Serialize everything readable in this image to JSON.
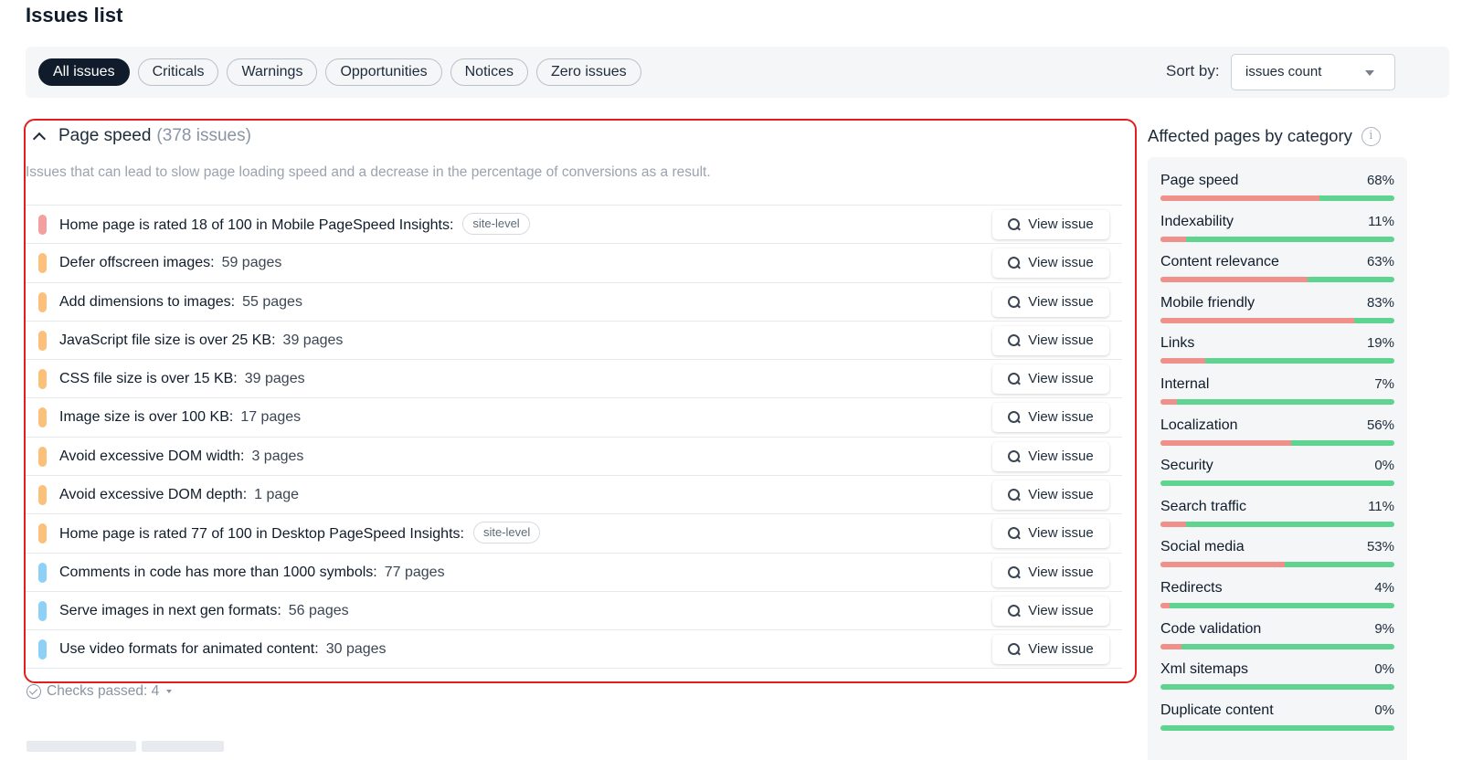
{
  "page": {
    "title": "Issues list"
  },
  "filters": {
    "tabs": [
      "All issues",
      "Criticals",
      "Warnings",
      "Opportunities",
      "Notices",
      "Zero issues"
    ],
    "active": "All issues",
    "sort_label": "Sort by:",
    "sort_value": "issues count"
  },
  "section": {
    "title": "Page speed",
    "count": "(378 issues)",
    "description": "Issues that can lead to slow page loading speed and a decrease in the percentage of conversions as a result.",
    "view_label": "View issue",
    "issues": [
      {
        "text": "Home page is rated 18 of 100 in Mobile PageSpeed Insights:",
        "pages": "",
        "badge": "site-level",
        "severity": "critical"
      },
      {
        "text": "Defer offscreen images:",
        "pages": "59 pages",
        "badge": "",
        "severity": "warning"
      },
      {
        "text": "Add dimensions to images:",
        "pages": "55 pages",
        "badge": "",
        "severity": "warning"
      },
      {
        "text": "JavaScript file size is over 25 KB:",
        "pages": "39 pages",
        "badge": "",
        "severity": "warning"
      },
      {
        "text": "CSS file size is over 15 KB:",
        "pages": "39 pages",
        "badge": "",
        "severity": "warning"
      },
      {
        "text": "Image size is over 100 KB:",
        "pages": "17 pages",
        "badge": "",
        "severity": "warning"
      },
      {
        "text": "Avoid excessive DOM width:",
        "pages": "3 pages",
        "badge": "",
        "severity": "warning"
      },
      {
        "text": "Avoid excessive DOM depth:",
        "pages": "1 page",
        "badge": "",
        "severity": "warning"
      },
      {
        "text": "Home page is rated 77 of 100 in Desktop PageSpeed Insights:",
        "pages": "",
        "badge": "site-level",
        "severity": "warning"
      },
      {
        "text": "Comments in code has more than 1000 symbols:",
        "pages": "77 pages",
        "badge": "",
        "severity": "opportunity"
      },
      {
        "text": "Serve images in next gen formats:",
        "pages": "56 pages",
        "badge": "",
        "severity": "opportunity"
      },
      {
        "text": "Use video formats for animated content:",
        "pages": "30 pages",
        "badge": "",
        "severity": "opportunity"
      }
    ],
    "checks_passed": "Checks passed: 4"
  },
  "severity_colors": {
    "critical": "#f4a0a0",
    "warning": "#fbc07a",
    "opportunity": "#8fd0f7"
  },
  "sidebar": {
    "title": "Affected pages by category",
    "info_icon": "i",
    "categories": [
      {
        "name": "Page speed",
        "pct": "68%",
        "value": 0.68
      },
      {
        "name": "Indexability",
        "pct": "11%",
        "value": 0.11
      },
      {
        "name": "Content relevance",
        "pct": "63%",
        "value": 0.63
      },
      {
        "name": "Mobile friendly",
        "pct": "83%",
        "value": 0.83
      },
      {
        "name": "Links",
        "pct": "19%",
        "value": 0.19
      },
      {
        "name": "Internal",
        "pct": "7%",
        "value": 0.07
      },
      {
        "name": "Localization",
        "pct": "56%",
        "value": 0.56
      },
      {
        "name": "Security",
        "pct": "0%",
        "value": 0.0
      },
      {
        "name": "Search traffic",
        "pct": "11%",
        "value": 0.11
      },
      {
        "name": "Social media",
        "pct": "53%",
        "value": 0.53
      },
      {
        "name": "Redirects",
        "pct": "4%",
        "value": 0.04
      },
      {
        "name": "Code validation",
        "pct": "9%",
        "value": 0.09
      },
      {
        "name": "Xml sitemaps",
        "pct": "0%",
        "value": 0.0
      },
      {
        "name": "Duplicate content",
        "pct": "0%",
        "value": 0.0
      }
    ]
  }
}
